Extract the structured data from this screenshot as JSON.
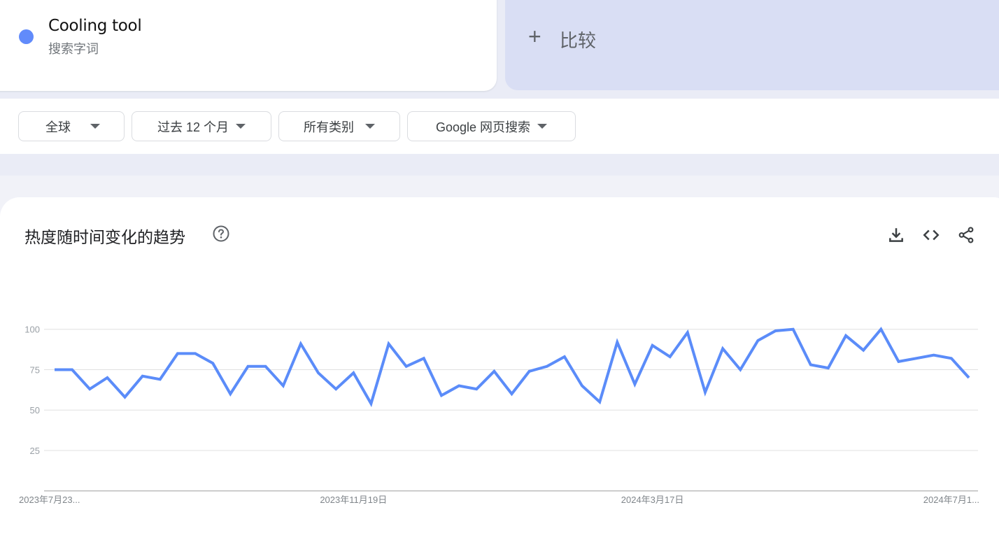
{
  "term": {
    "name": "Cooling tool",
    "type": "搜索字词",
    "color": "#618BFB"
  },
  "compare": {
    "icon": "plus-icon",
    "plus_glyph": "+",
    "label": "比较"
  },
  "filters": [
    {
      "label": "全球"
    },
    {
      "label": "过去 12 个月"
    },
    {
      "label": "所有类别"
    },
    {
      "label": "Google 网页搜索"
    }
  ],
  "chart_section": {
    "title": "热度随时间变化的趋势",
    "help_icon": "help-circle-icon",
    "tools": [
      "download-icon",
      "embed-code-icon",
      "share-icon"
    ]
  },
  "chart_data": {
    "type": "line",
    "title": "热度随时间变化的趋势",
    "xlabel": "",
    "ylabel": "",
    "ylim": [
      0,
      100
    ],
    "yticks": [
      25,
      50,
      75,
      100
    ],
    "grid": true,
    "x_tick_labels": [
      {
        "index": 0,
        "label": "2023年7月23...",
        "align": "start"
      },
      {
        "index": 17,
        "label": "2023年11月19日",
        "align": "middle"
      },
      {
        "index": 34,
        "label": "2024年3月17日",
        "align": "middle"
      },
      {
        "index": 51,
        "label": "2024年7月1...",
        "align": "middle"
      }
    ],
    "series": [
      {
        "name": "Cooling tool",
        "color": "#5B8CF9",
        "values": [
          75,
          75,
          63,
          70,
          58,
          71,
          69,
          85,
          85,
          79,
          60,
          77,
          77,
          65,
          91,
          73,
          63,
          73,
          54,
          91,
          77,
          82,
          59,
          65,
          63,
          74,
          60,
          74,
          77,
          83,
          65,
          55,
          92,
          66,
          90,
          83,
          98,
          61,
          88,
          75,
          93,
          99,
          100,
          78,
          76,
          96,
          87,
          100,
          80,
          82,
          84,
          82,
          70
        ]
      }
    ]
  }
}
